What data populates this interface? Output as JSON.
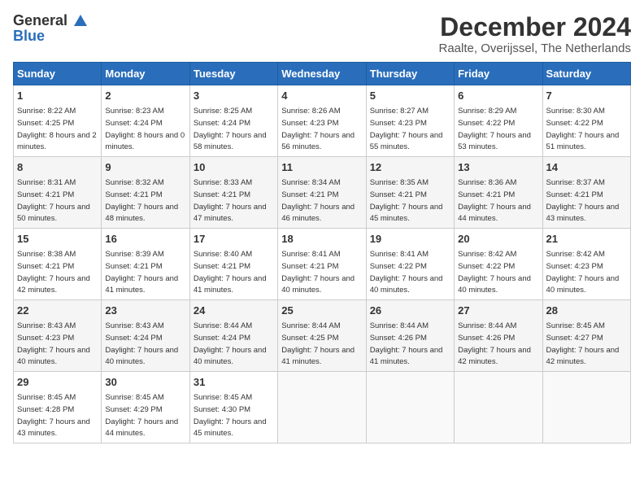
{
  "logo": {
    "line1": "General",
    "line2": "Blue"
  },
  "title": "December 2024",
  "location": "Raalte, Overijssel, The Netherlands",
  "days_of_week": [
    "Sunday",
    "Monday",
    "Tuesday",
    "Wednesday",
    "Thursday",
    "Friday",
    "Saturday"
  ],
  "weeks": [
    [
      {
        "day": "1",
        "sunrise": "8:22 AM",
        "sunset": "4:25 PM",
        "daylight": "8 hours and 2 minutes."
      },
      {
        "day": "2",
        "sunrise": "8:23 AM",
        "sunset": "4:24 PM",
        "daylight": "8 hours and 0 minutes."
      },
      {
        "day": "3",
        "sunrise": "8:25 AM",
        "sunset": "4:24 PM",
        "daylight": "7 hours and 58 minutes."
      },
      {
        "day": "4",
        "sunrise": "8:26 AM",
        "sunset": "4:23 PM",
        "daylight": "7 hours and 56 minutes."
      },
      {
        "day": "5",
        "sunrise": "8:27 AM",
        "sunset": "4:23 PM",
        "daylight": "7 hours and 55 minutes."
      },
      {
        "day": "6",
        "sunrise": "8:29 AM",
        "sunset": "4:22 PM",
        "daylight": "7 hours and 53 minutes."
      },
      {
        "day": "7",
        "sunrise": "8:30 AM",
        "sunset": "4:22 PM",
        "daylight": "7 hours and 51 minutes."
      }
    ],
    [
      {
        "day": "8",
        "sunrise": "8:31 AM",
        "sunset": "4:21 PM",
        "daylight": "7 hours and 50 minutes."
      },
      {
        "day": "9",
        "sunrise": "8:32 AM",
        "sunset": "4:21 PM",
        "daylight": "7 hours and 48 minutes."
      },
      {
        "day": "10",
        "sunrise": "8:33 AM",
        "sunset": "4:21 PM",
        "daylight": "7 hours and 47 minutes."
      },
      {
        "day": "11",
        "sunrise": "8:34 AM",
        "sunset": "4:21 PM",
        "daylight": "7 hours and 46 minutes."
      },
      {
        "day": "12",
        "sunrise": "8:35 AM",
        "sunset": "4:21 PM",
        "daylight": "7 hours and 45 minutes."
      },
      {
        "day": "13",
        "sunrise": "8:36 AM",
        "sunset": "4:21 PM",
        "daylight": "7 hours and 44 minutes."
      },
      {
        "day": "14",
        "sunrise": "8:37 AM",
        "sunset": "4:21 PM",
        "daylight": "7 hours and 43 minutes."
      }
    ],
    [
      {
        "day": "15",
        "sunrise": "8:38 AM",
        "sunset": "4:21 PM",
        "daylight": "7 hours and 42 minutes."
      },
      {
        "day": "16",
        "sunrise": "8:39 AM",
        "sunset": "4:21 PM",
        "daylight": "7 hours and 41 minutes."
      },
      {
        "day": "17",
        "sunrise": "8:40 AM",
        "sunset": "4:21 PM",
        "daylight": "7 hours and 41 minutes."
      },
      {
        "day": "18",
        "sunrise": "8:41 AM",
        "sunset": "4:21 PM",
        "daylight": "7 hours and 40 minutes."
      },
      {
        "day": "19",
        "sunrise": "8:41 AM",
        "sunset": "4:22 PM",
        "daylight": "7 hours and 40 minutes."
      },
      {
        "day": "20",
        "sunrise": "8:42 AM",
        "sunset": "4:22 PM",
        "daylight": "7 hours and 40 minutes."
      },
      {
        "day": "21",
        "sunrise": "8:42 AM",
        "sunset": "4:23 PM",
        "daylight": "7 hours and 40 minutes."
      }
    ],
    [
      {
        "day": "22",
        "sunrise": "8:43 AM",
        "sunset": "4:23 PM",
        "daylight": "7 hours and 40 minutes."
      },
      {
        "day": "23",
        "sunrise": "8:43 AM",
        "sunset": "4:24 PM",
        "daylight": "7 hours and 40 minutes."
      },
      {
        "day": "24",
        "sunrise": "8:44 AM",
        "sunset": "4:24 PM",
        "daylight": "7 hours and 40 minutes."
      },
      {
        "day": "25",
        "sunrise": "8:44 AM",
        "sunset": "4:25 PM",
        "daylight": "7 hours and 41 minutes."
      },
      {
        "day": "26",
        "sunrise": "8:44 AM",
        "sunset": "4:26 PM",
        "daylight": "7 hours and 41 minutes."
      },
      {
        "day": "27",
        "sunrise": "8:44 AM",
        "sunset": "4:26 PM",
        "daylight": "7 hours and 42 minutes."
      },
      {
        "day": "28",
        "sunrise": "8:45 AM",
        "sunset": "4:27 PM",
        "daylight": "7 hours and 42 minutes."
      }
    ],
    [
      {
        "day": "29",
        "sunrise": "8:45 AM",
        "sunset": "4:28 PM",
        "daylight": "7 hours and 43 minutes."
      },
      {
        "day": "30",
        "sunrise": "8:45 AM",
        "sunset": "4:29 PM",
        "daylight": "7 hours and 44 minutes."
      },
      {
        "day": "31",
        "sunrise": "8:45 AM",
        "sunset": "4:30 PM",
        "daylight": "7 hours and 45 minutes."
      },
      null,
      null,
      null,
      null
    ]
  ],
  "labels": {
    "sunrise": "Sunrise:",
    "sunset": "Sunset:",
    "daylight": "Daylight:"
  }
}
